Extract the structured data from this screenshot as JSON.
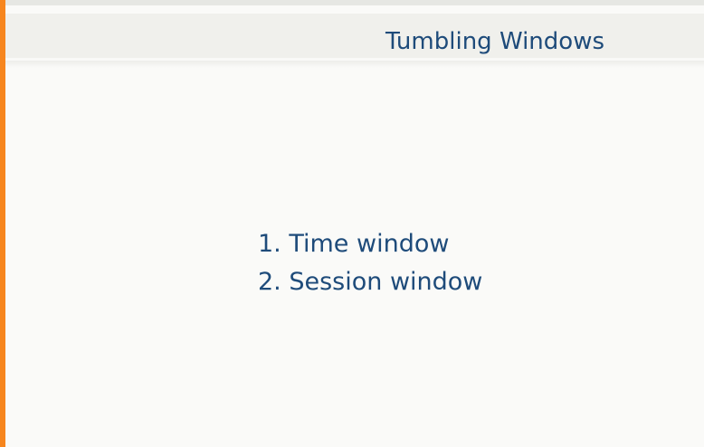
{
  "slide": {
    "title": "Tumbling Windows",
    "items": [
      "1. Time window",
      "2. Session window"
    ]
  },
  "colors": {
    "accent": "#f7861e",
    "text": "#1e4b7a",
    "background": "#fafaf8",
    "title_band": "#f0f0ec"
  }
}
